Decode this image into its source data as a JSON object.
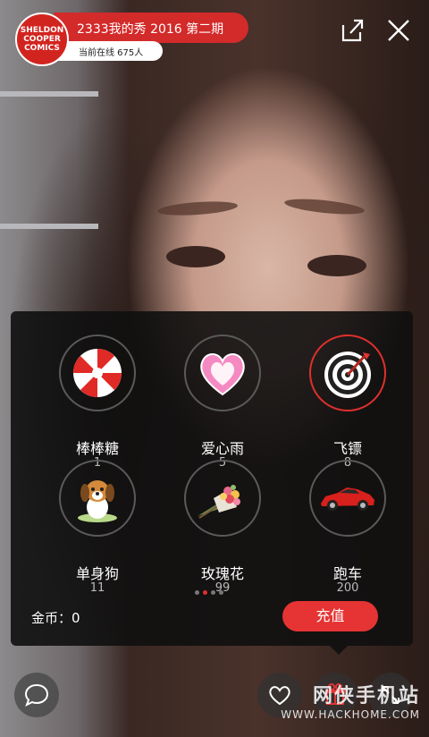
{
  "header": {
    "logo_lines": [
      "SHELDON",
      "COOPER",
      "COMICS"
    ],
    "title": "2333我的秀 2016 第二期",
    "online": "当前在线 675人"
  },
  "gifts": [
    {
      "name": "棒棒糖",
      "price": "1",
      "icon": "candy-icon"
    },
    {
      "name": "爱心雨",
      "price": "5",
      "icon": "heart-icon"
    },
    {
      "name": "飞镖",
      "price": "8",
      "icon": "dartboard-icon"
    },
    {
      "name": "单身狗",
      "price": "11",
      "icon": "dog-icon"
    },
    {
      "name": "玫瑰花",
      "price": "99",
      "icon": "bouquet-icon"
    },
    {
      "name": "跑车",
      "price": "200",
      "icon": "sports-car-icon"
    }
  ],
  "selected_gift": 2,
  "pager": {
    "count": 4,
    "active": 1
  },
  "wallet": {
    "coins_label": "金币：0"
  },
  "recharge_label": "充值",
  "watermark": {
    "main": "网侠手机站",
    "sub": "WWW.HACKHOME.COM"
  },
  "colors": {
    "accent": "#e53433",
    "panel": "#101010"
  }
}
